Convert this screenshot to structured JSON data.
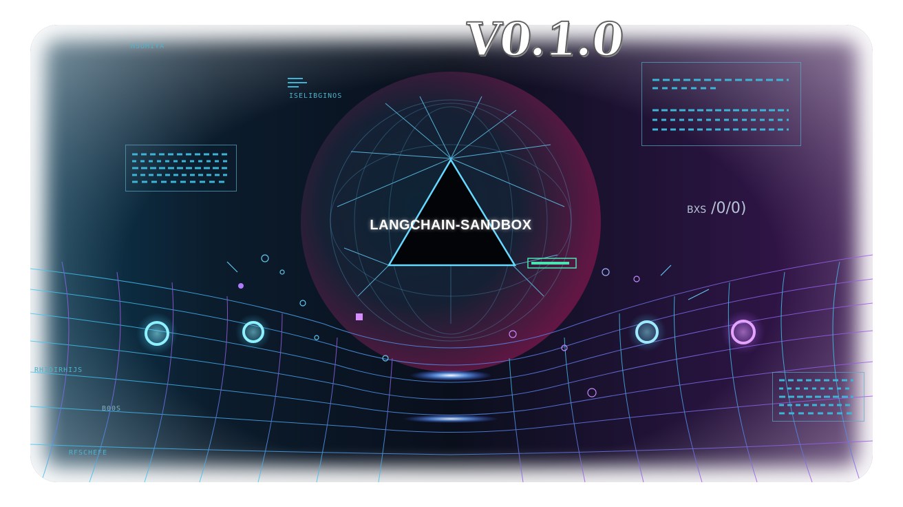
{
  "version": "V0.1.0",
  "brand_title": "LANGCHAIN-SANDBOX",
  "labels": {
    "top_left": "HSUMIYA",
    "left_middle": "ISELIBGINOS",
    "right_side_prefix": "BXS",
    "right_side_suffix": "/0/0)",
    "left_lower": "RHIDIRHIJS",
    "left_code": "B00S",
    "left_bottom": "RFSCHEFE"
  },
  "colors": {
    "cyan": "#39c6ee",
    "magenta": "#a64cf0",
    "background_dark": "#0a0f1c"
  },
  "icons": [
    "network-sphere-icon",
    "triangle-prism-icon",
    "ring-node-icon",
    "wireframe-grid-icon"
  ]
}
